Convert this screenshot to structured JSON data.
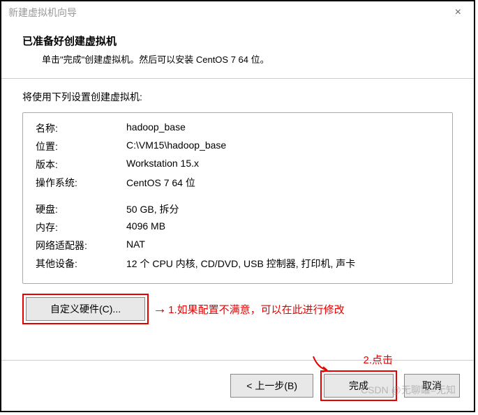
{
  "window": {
    "title": "新建虚拟机向导"
  },
  "header": {
    "title": "已准备好创建虚拟机",
    "subtitle": "单击\"完成\"创建虚拟机。然后可以安装 CentOS 7 64 位。"
  },
  "content": {
    "intro": "将使用下列设置创建虚拟机:"
  },
  "settings": {
    "name_label": "名称:",
    "name_value": "hadoop_base",
    "location_label": "位置:",
    "location_value": "C:\\VM15\\hadoop_base",
    "version_label": "版本:",
    "version_value": "Workstation 15.x",
    "os_label": "操作系统:",
    "os_value": "CentOS 7 64 位",
    "disk_label": "硬盘:",
    "disk_value": "50 GB, 拆分",
    "memory_label": "内存:",
    "memory_value": "4096 MB",
    "network_label": "网络适配器:",
    "network_value": "NAT",
    "other_label": "其他设备:",
    "other_value": "12 个 CPU 内核, CD/DVD, USB 控制器, 打印机, 声卡"
  },
  "buttons": {
    "customize_hw": "自定义硬件(C)...",
    "back": "< 上一步(B)",
    "finish": "完成",
    "cancel": "取消"
  },
  "annotations": {
    "step1": "1.如果配置不满意，可以在此进行修改",
    "step2": "2.点击",
    "arrow": "→"
  },
  "watermark": "CSDN @无聊罐=无知"
}
